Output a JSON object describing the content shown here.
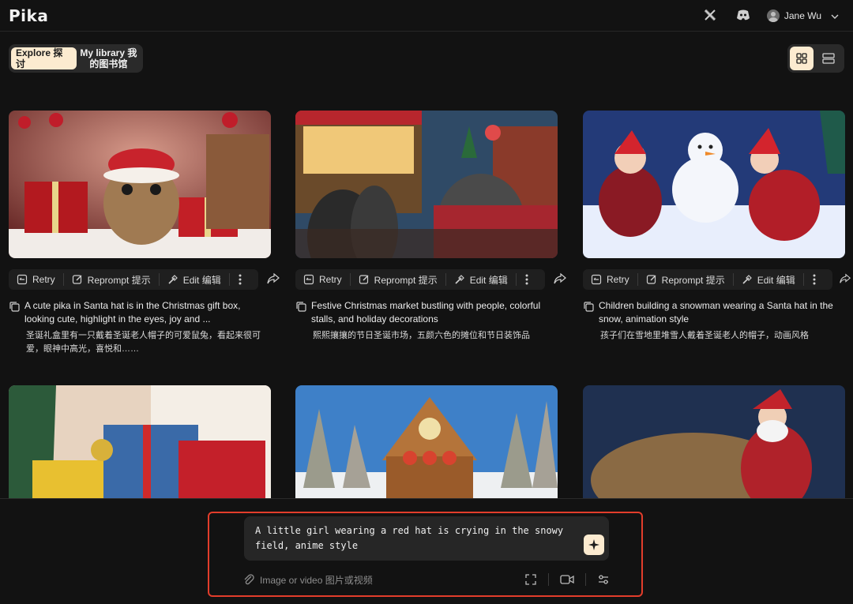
{
  "header": {
    "logo": "Pika",
    "user_name": "Jane Wu",
    "icons": [
      "x-logo-icon",
      "discord-icon",
      "avatar",
      "chevron-down-icon"
    ]
  },
  "tabs": {
    "explore": "Explore 探讨",
    "library": "My library 我的图书馆"
  },
  "view_toggle": {
    "grid": "grid-view-icon",
    "list": "list-view-icon",
    "active": "grid"
  },
  "actions": {
    "retry": "Retry",
    "reprompt": "Reprompt 提示",
    "edit": "Edit 编辑"
  },
  "cards": [
    {
      "prompt_en": "A cute pika in Santa hat is in the Christmas gift box, looking cute, highlight in the eyes, joy and ...",
      "prompt_zh": "圣诞礼盒里有一只戴着圣诞老人帽子的可爱鼠兔，看起来很可爱，眼神中高光，喜悦和……"
    },
    {
      "prompt_en": "Festive Christmas market bustling with people, colorful stalls, and holiday decorations",
      "prompt_zh": "熙熙攘攘的节日圣诞市场，五颜六色的摊位和节日装饰品"
    },
    {
      "prompt_en": "Children building a snowman wearing a Santa hat in the snow, animation style",
      "prompt_zh": "孩子们在雪地里堆雪人戴着圣诞老人的帽子，动画风格"
    }
  ],
  "composer": {
    "text": "A little girl wearing a red hat is crying in the snowy field, anime style",
    "attach_label": "Image or video 图片或视频",
    "accent": "#fcebd0",
    "highlight_border": "#e23d2b"
  }
}
